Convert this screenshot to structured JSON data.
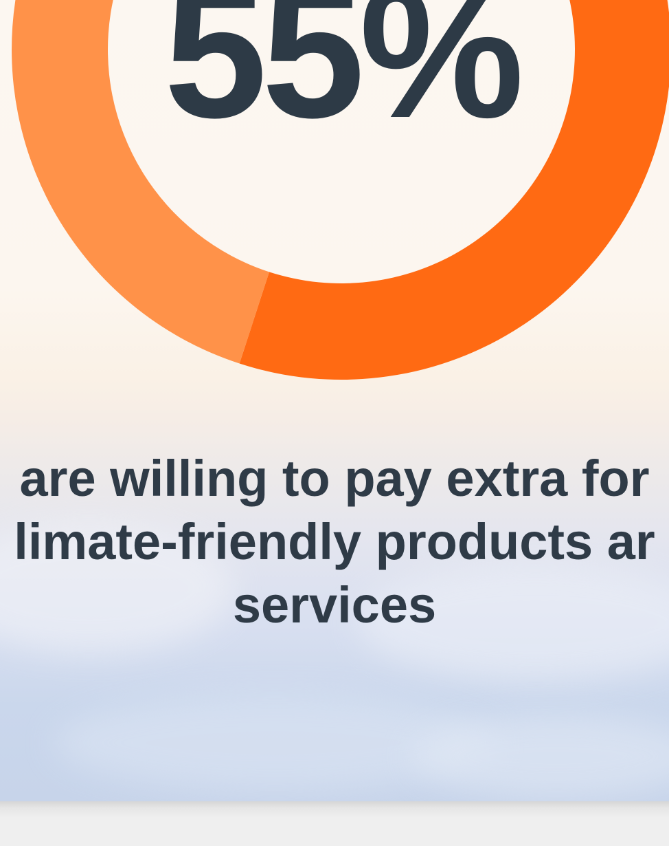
{
  "chart_data": {
    "type": "pie",
    "title": "",
    "values": [
      55,
      45
    ],
    "colors": [
      "#ff6a13",
      "#ff9249"
    ],
    "center_label": "55%",
    "caption_lines": [
      "are willing to pay extra for",
      "limate-friendly products ar",
      "services"
    ]
  }
}
